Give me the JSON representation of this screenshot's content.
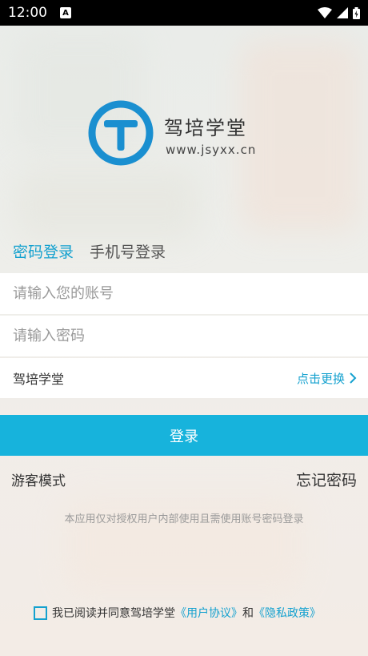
{
  "status_bar": {
    "time": "12:00",
    "notification_icon": "a-icon"
  },
  "brand": {
    "name": "驾培学堂",
    "url": "www.jsyxx.cn",
    "logo_letter": "T",
    "accent": "#1a8fd0"
  },
  "tabs": [
    {
      "label": "密码登录",
      "active": true
    },
    {
      "label": "手机号登录",
      "active": false
    }
  ],
  "account_input": {
    "placeholder": "请输入您的账号",
    "value": ""
  },
  "password_input": {
    "placeholder": "请输入密码",
    "value": ""
  },
  "school": {
    "name": "驾培学堂",
    "change_label": "点击更换"
  },
  "login_button": {
    "label": "登录",
    "color": "#17b3dc"
  },
  "guest_mode": {
    "label": "游客模式"
  },
  "forgot_password": {
    "label": "忘记密码"
  },
  "notice": "本应用仅对授权用户内部使用且需使用账号密码登录",
  "agreement": {
    "checked": false,
    "prefix": "我已阅读并同意驾培学堂",
    "user_agreement": "《用户协议》",
    "and": "和",
    "privacy_policy": "《隐私政策》"
  }
}
